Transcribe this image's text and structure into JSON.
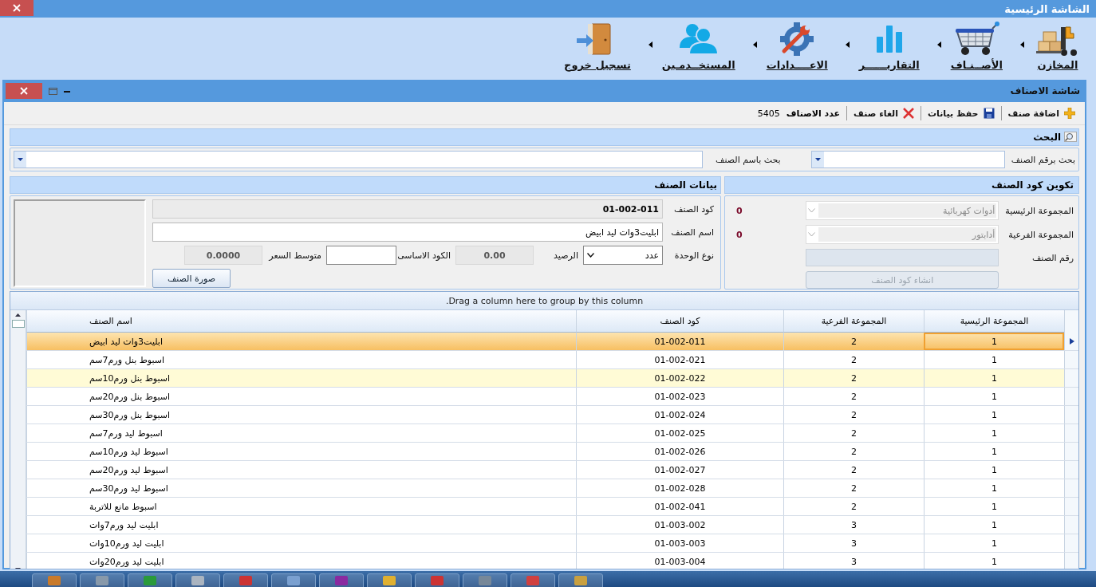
{
  "window": {
    "title": "الشاشة الرئيسية"
  },
  "ribbon": [
    {
      "label": "المخازن"
    },
    {
      "label": "الأصــنـاف"
    },
    {
      "label": "التقاريــــــر"
    },
    {
      "label": "الاعــــدادات"
    },
    {
      "label": "المستخــدمـين"
    },
    {
      "label": "تسجيل خروج"
    }
  ],
  "child_window": {
    "title": "شاشة الاصناف"
  },
  "toolbar": {
    "buttons": [
      {
        "label": "اضافة صنف"
      },
      {
        "label": "حفظ بيانات"
      },
      {
        "label": "الغاء صنف"
      }
    ],
    "count_label": "عدد الاصناف",
    "count": "5405"
  },
  "search": {
    "title": "البحث",
    "by_number_label": "بحث برقم الصنف",
    "by_name_label": "بحث باسم الصنف"
  },
  "code_panel": {
    "title": "تكوين كود الصنف",
    "groups": [
      {
        "label": "المجموعة الرئيسية",
        "value": "أدوات كهربائية",
        "count": "0",
        "disabled": true
      },
      {
        "label": "المجموعة الفرعية",
        "value": "أدابتور",
        "count": "0",
        "disabled": true
      }
    ],
    "item_number_label": "رقم الصنف",
    "generate_button": {
      "label": "انشاء كود الصنف",
      "disabled": true
    }
  },
  "item_panel": {
    "title": "بيانات الصنف",
    "code_label": "كود الصنف",
    "code": "01-002-011",
    "name_label": "اسم الصنف",
    "name": "ابليت3وات ليد ابيض",
    "unit_label": "نوع الوحدة",
    "unit": "عدد",
    "balance_label": "الرصيد",
    "balance": "0.00",
    "base_code_label": "الكود الاساسى",
    "avg_price_label": "متوسط السعر",
    "avg_price": "0.0000",
    "image_button": "صورة الصنف"
  },
  "grid": {
    "group_hint": "Drag a column here to group by this column.",
    "columns": [
      "المجموعة الرئيسية",
      "المجموعة الفرعية",
      "كود الصنف",
      "اسم الصنف"
    ],
    "rows": [
      {
        "cells": [
          "1",
          "2",
          "01-002-011",
          "ابليت3وات ليد ابيض"
        ],
        "selected": true,
        "highlighted": false
      },
      {
        "cells": [
          "1",
          "2",
          "01-002-021",
          "اسبوط بنل ورم7سم"
        ],
        "selected": false,
        "highlighted": false
      },
      {
        "cells": [
          "1",
          "2",
          "01-002-022",
          "اسبوط بنل ورم10سم"
        ],
        "selected": false,
        "highlighted": true
      },
      {
        "cells": [
          "1",
          "2",
          "01-002-023",
          "اسبوط بنل ورم20سم"
        ],
        "selected": false,
        "highlighted": false
      },
      {
        "cells": [
          "1",
          "2",
          "01-002-024",
          "اسبوط بنل ورم30سم"
        ],
        "selected": false,
        "highlighted": false
      },
      {
        "cells": [
          "1",
          "2",
          "01-002-025",
          "اسبوط ليد ورم7سم"
        ],
        "selected": false,
        "highlighted": false
      },
      {
        "cells": [
          "1",
          "2",
          "01-002-026",
          "اسبوط ليد ورم10سم"
        ],
        "selected": false,
        "highlighted": false
      },
      {
        "cells": [
          "1",
          "2",
          "01-002-027",
          "اسبوط ليد ورم20سم"
        ],
        "selected": false,
        "highlighted": false
      },
      {
        "cells": [
          "1",
          "2",
          "01-002-028",
          "اسبوط ليد ورم30سم"
        ],
        "selected": false,
        "highlighted": false
      },
      {
        "cells": [
          "1",
          "2",
          "01-002-041",
          "اسبوط مانع للاتربة"
        ],
        "selected": false,
        "highlighted": false
      },
      {
        "cells": [
          "1",
          "3",
          "01-003-002",
          "ابليت ليد ورم7وات"
        ],
        "selected": false,
        "highlighted": false
      },
      {
        "cells": [
          "1",
          "3",
          "01-003-003",
          "ابليت ليد ورم10وات"
        ],
        "selected": false,
        "highlighted": false
      },
      {
        "cells": [
          "1",
          "3",
          "01-003-004",
          "ابليت ليد ورم20وات"
        ],
        "selected": false,
        "highlighted": false
      }
    ]
  }
}
